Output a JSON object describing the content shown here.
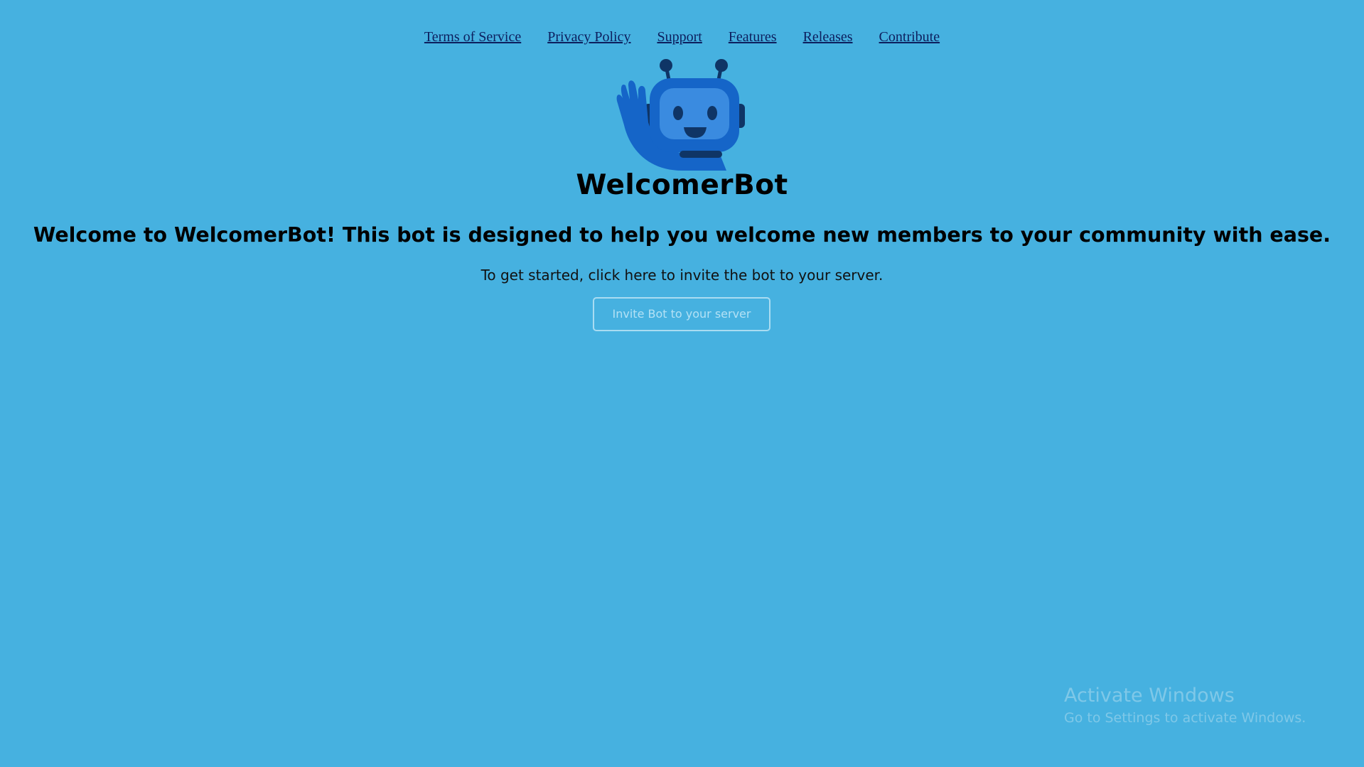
{
  "nav": {
    "links": [
      {
        "label": "Terms of Service"
      },
      {
        "label": "Privacy Policy"
      },
      {
        "label": "Support"
      },
      {
        "label": "Features"
      },
      {
        "label": "Releases"
      },
      {
        "label": "Contribute"
      }
    ]
  },
  "logo": {
    "icon": "robot-waving-icon"
  },
  "brand": {
    "name": "WelcomerBot"
  },
  "hero": {
    "headline": "Welcome to WelcomerBot! This bot is designed to help you welcome new members to your community with ease.",
    "intro": "To get started, click here to invite the bot to your server.",
    "invite_button": "Invite Bot to your server"
  },
  "watermark": {
    "title": "Activate Windows",
    "subtitle": "Go to Settings to activate Windows."
  },
  "colors": {
    "background": "#46b1e0",
    "link": "#0d1f5e",
    "robot_body": "#1565c8",
    "robot_dark": "#0f3566"
  }
}
